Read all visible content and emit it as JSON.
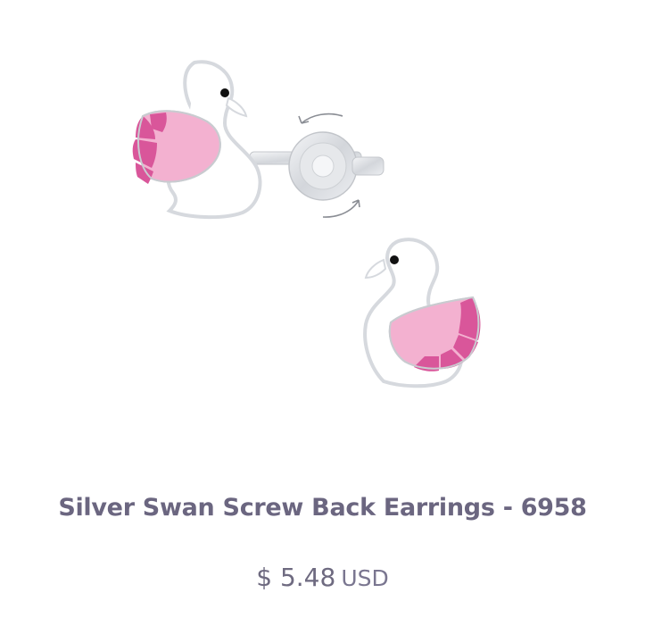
{
  "product": {
    "title": "Silver Swan Screw Back Earrings - 6958",
    "price": "$ 5.48",
    "currency": "USD",
    "image_icon": "swan-earrings-image"
  },
  "colors": {
    "title": "#6b6680",
    "price": "#6e6a80",
    "wing_light": "#f2b0cf",
    "wing_dark": "#d9569a",
    "silver": "#d8dadf"
  }
}
